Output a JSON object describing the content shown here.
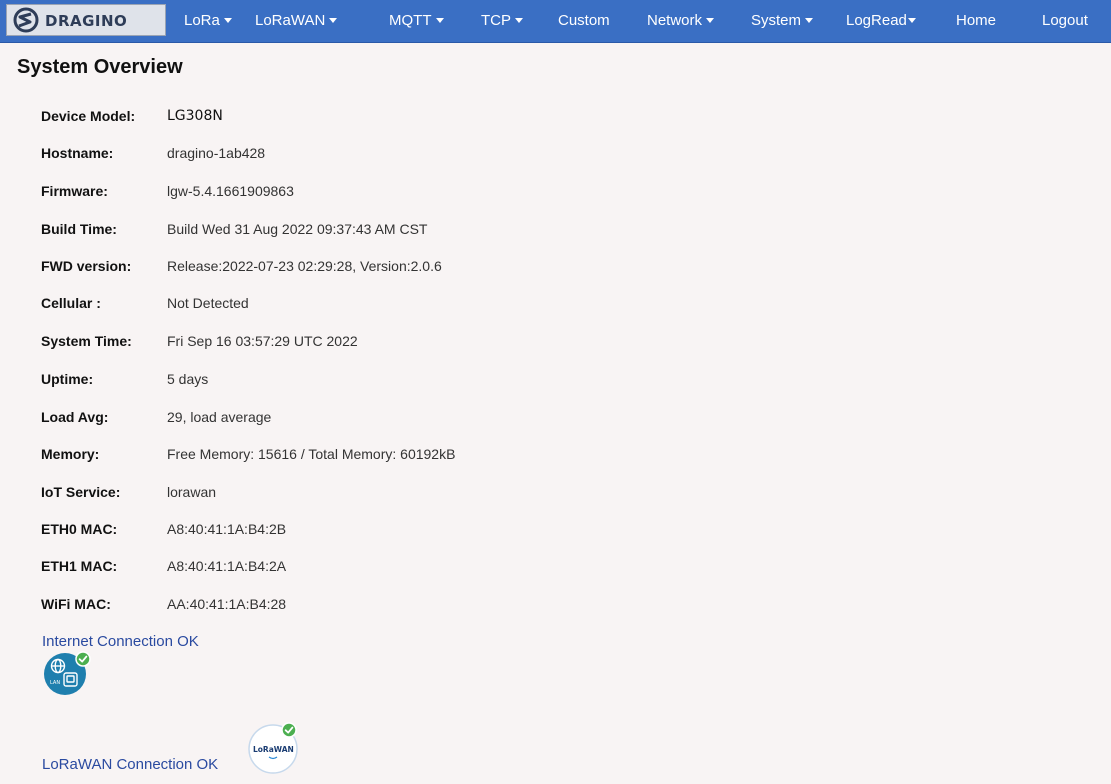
{
  "navbar": {
    "logo_text": "DRAGINO",
    "items": [
      {
        "label": "LoRa",
        "dropdown": true
      },
      {
        "label": "LoRaWAN",
        "dropdown": true
      },
      {
        "label": "MQTT",
        "dropdown": true
      },
      {
        "label": "TCP",
        "dropdown": true
      },
      {
        "label": "Custom",
        "dropdown": false
      },
      {
        "label": "Network",
        "dropdown": true
      },
      {
        "label": "System",
        "dropdown": true
      },
      {
        "label": "LogRead",
        "dropdown": true
      },
      {
        "label": "Home",
        "dropdown": false
      },
      {
        "label": "Logout",
        "dropdown": false
      }
    ]
  },
  "page": {
    "title": "System Overview"
  },
  "overview": [
    {
      "label": "Device Model:",
      "value": "LG308N"
    },
    {
      "label": "Hostname:",
      "value": "dragino-1ab428"
    },
    {
      "label": "Firmware:",
      "value": "lgw-5.4.1661909863"
    },
    {
      "label": "Build Time:",
      "value": "Build Wed 31 Aug 2022 09:37:43 AM CST"
    },
    {
      "label": "FWD version:",
      "value": "Release:2022-07-23 02:29:28, Version:2.0.6"
    },
    {
      "label": "Cellular :",
      "value": "Not Detected"
    },
    {
      "label": "System Time:",
      "value": "Fri Sep 16 03:57:29 UTC 2022"
    },
    {
      "label": "Uptime:",
      "value": "5 days"
    },
    {
      "label": "Load Avg:",
      "value": "29, load average"
    },
    {
      "label": "Memory:",
      "value": "Free Memory: 15616 / Total Memory: 60192kB"
    },
    {
      "label": "IoT Service:",
      "value": "lorawan"
    },
    {
      "label": "ETH0 MAC:",
      "value": "A8:40:41:1A:B4:2B"
    },
    {
      "label": "ETH1 MAC:",
      "value": "A8:40:41:1A:B4:2A"
    },
    {
      "label": "WiFi MAC:",
      "value": "AA:40:41:1A:B4:28"
    }
  ],
  "status": {
    "internet": {
      "text": "Internet Connection OK",
      "icon_label": "LAN"
    },
    "lorawan": {
      "text": "LoRaWAN Connection OK",
      "icon_label": "LoRaWAN"
    }
  },
  "colors": {
    "navbar": "#3a6fc4",
    "status_text": "#2a4aa0",
    "check_green": "#4caf50",
    "globe_badge": "#1f7fae"
  }
}
